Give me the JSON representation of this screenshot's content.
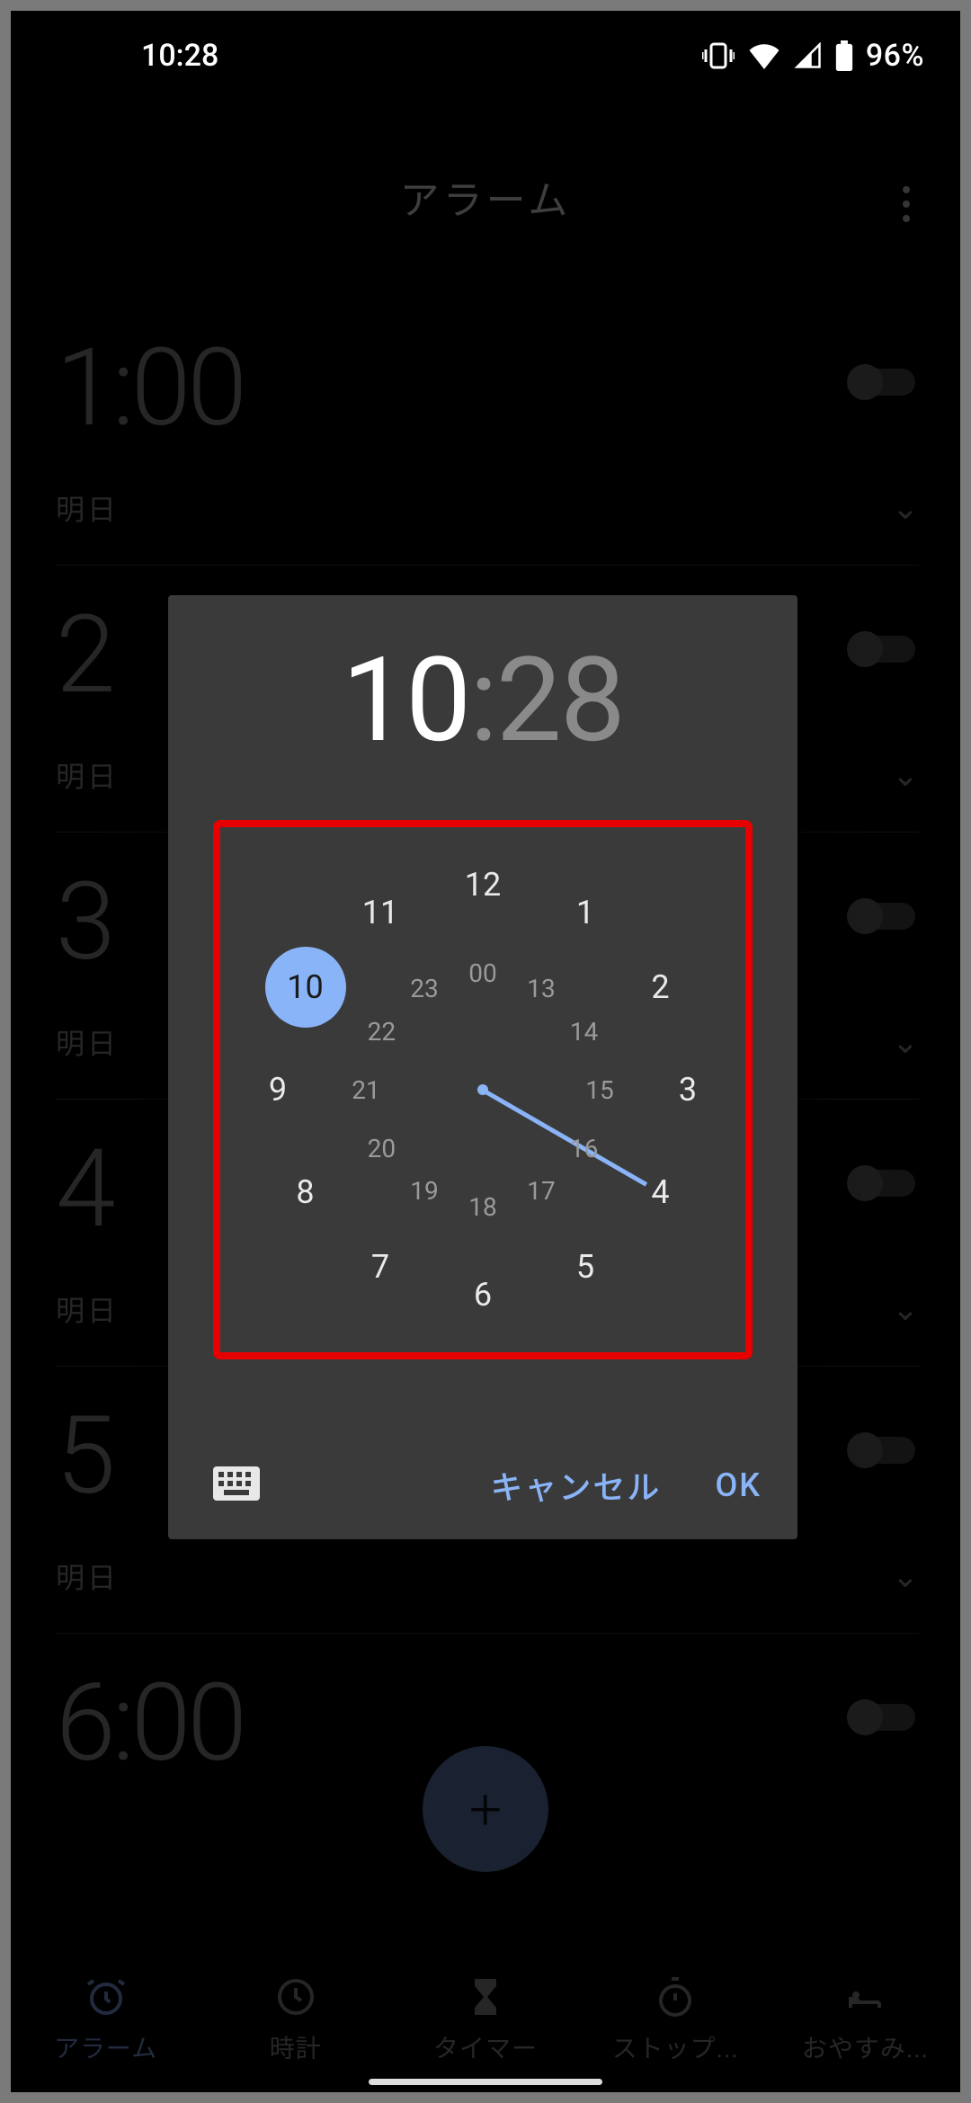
{
  "status": {
    "time": "10:28",
    "battery": "96%"
  },
  "header": {
    "title": "アラーム"
  },
  "alarms": [
    {
      "time": "1:00",
      "sub": "明日"
    },
    {
      "time": "2",
      "sub": "明日"
    },
    {
      "time": "3",
      "sub": "明日"
    },
    {
      "time": "4",
      "sub": "明日"
    },
    {
      "time": "5",
      "sub": "明日"
    },
    {
      "time": "6:00",
      "sub": ""
    }
  ],
  "picker": {
    "hour": "10",
    "minute": "28",
    "cancel": "キャンセル",
    "ok": "OK",
    "outer": [
      "12",
      "1",
      "2",
      "3",
      "4",
      "5",
      "6",
      "7",
      "8",
      "9",
      "10",
      "11"
    ],
    "inner": [
      "00",
      "13",
      "14",
      "15",
      "16",
      "17",
      "18",
      "19",
      "20",
      "21",
      "22",
      "23"
    ],
    "selected_hour_index": 10
  },
  "nav": {
    "items": [
      {
        "label": "アラーム"
      },
      {
        "label": "時計"
      },
      {
        "label": "タイマー"
      },
      {
        "label": "ストップ..."
      },
      {
        "label": "おやすみ..."
      }
    ]
  }
}
